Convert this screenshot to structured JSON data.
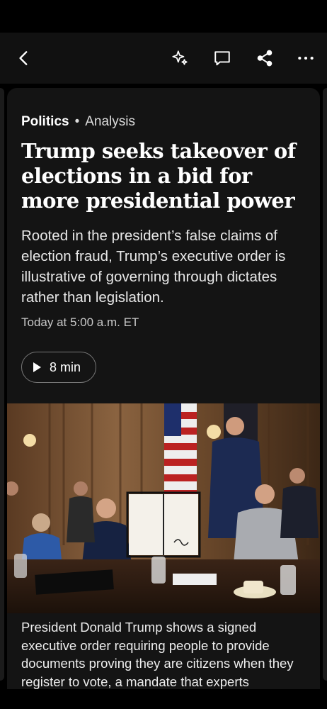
{
  "toolbar": {
    "icons": [
      "back-icon",
      "ai-sparkle-icon",
      "comment-icon",
      "share-icon",
      "more-icon"
    ]
  },
  "article": {
    "section": "Politics",
    "separator": "•",
    "label": "Analysis",
    "headline": "Trump seeks takeover of elections in a bid for more presidential power",
    "dek": "Rooted in the president’s false claims of election fraud, Trump’s executive order is illustrative of governing through dictates rather than legislation.",
    "timestamp": "Today at 5:00 a.m. ET",
    "audio_duration": "8 min",
    "caption": "President Donald Trump shows a signed executive order requiring people to provide documents proving they are citizens when they register to vote, a mandate that experts"
  },
  "colors": {
    "background": "#000000",
    "toolbar": "#111111",
    "card": "#141414",
    "text": "#ffffff"
  }
}
